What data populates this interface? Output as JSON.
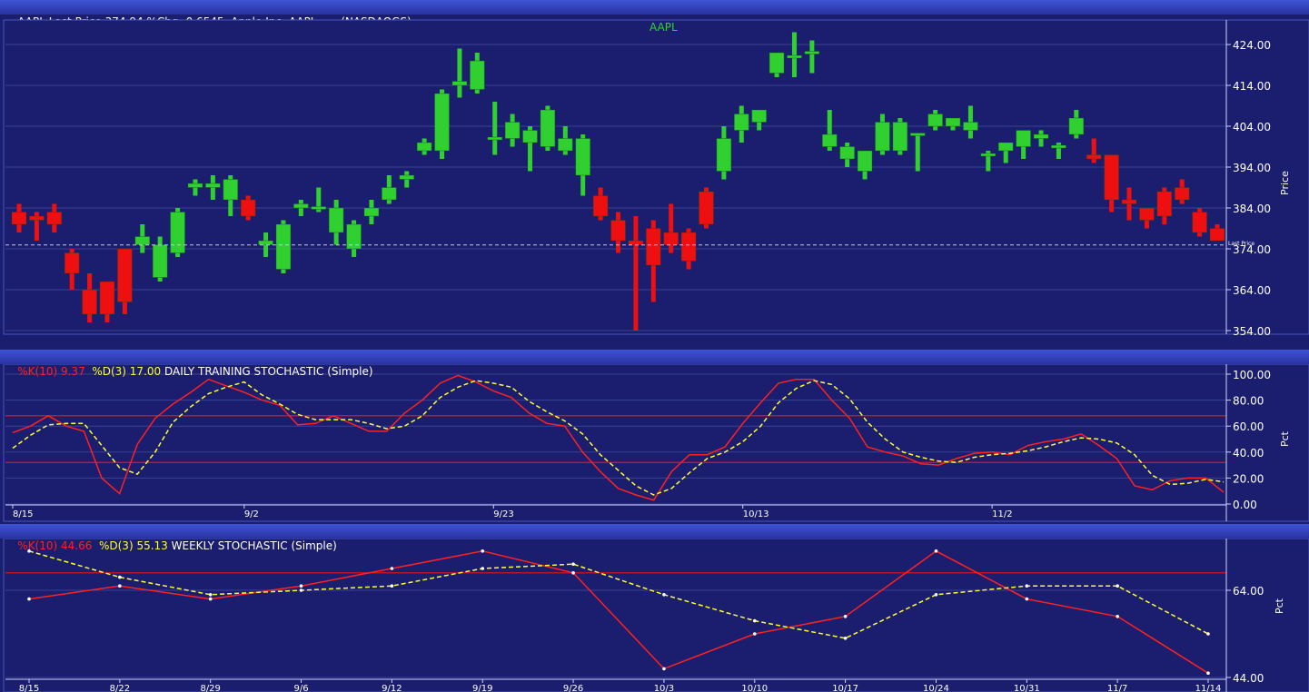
{
  "header": {
    "main": "AAPL.Last Price 374.94 %Chg -0.6545  Apple Inc.-AAPL       (NASDAQGS)"
  },
  "panels": {
    "daily": {
      "k_label": "%K(10) 9.37",
      "d_label": "%D(3) 17.00",
      "title": "DAILY TRAINING STOCHASTIC (Simple)"
    },
    "weekly": {
      "k_label": "%K(10) 44.66",
      "d_label": "%D(3) 55.13",
      "title": "WEEKLY STOCHASTIC (Simple)"
    }
  },
  "colors": {
    "up": "#30d030",
    "down": "#ee1010",
    "k_line": "#ff2020",
    "d_line": "#ffff30",
    "bg": "#1b1e6e",
    "grid": "#3b4095"
  },
  "chart_data": [
    {
      "type": "candlestick",
      "title": "AAPL",
      "ylabel": "Price",
      "ylim": [
        354,
        428
      ],
      "yticks": [
        "424.00",
        "414.00",
        "404.00",
        "394.00",
        "384.00",
        "374.00",
        "364.00",
        "354.00"
      ],
      "last_price": 374.94,
      "last_price_label": "Last Price",
      "candles": [
        {
          "o": 383,
          "h": 385,
          "l": 378,
          "c": 380
        },
        {
          "o": 382,
          "h": 383,
          "l": 376,
          "c": 381
        },
        {
          "o": 383,
          "h": 385,
          "l": 378,
          "c": 380
        },
        {
          "o": 373,
          "h": 374,
          "l": 364,
          "c": 368
        },
        {
          "o": 364,
          "h": 368,
          "l": 356,
          "c": 358
        },
        {
          "o": 366,
          "h": 366,
          "l": 356,
          "c": 358
        },
        {
          "o": 374,
          "h": 374,
          "l": 358,
          "c": 361
        },
        {
          "o": 375,
          "h": 380,
          "l": 373,
          "c": 377
        },
        {
          "o": 367,
          "h": 377,
          "l": 366,
          "c": 375
        },
        {
          "o": 373,
          "h": 384,
          "l": 372,
          "c": 383
        },
        {
          "o": 389,
          "h": 391,
          "l": 387,
          "c": 390
        },
        {
          "o": 389,
          "h": 392,
          "l": 386,
          "c": 390
        },
        {
          "o": 386,
          "h": 392,
          "l": 382,
          "c": 391
        },
        {
          "o": 386,
          "h": 387,
          "l": 381,
          "c": 382
        },
        {
          "o": 375,
          "h": 378,
          "l": 372,
          "c": 376
        },
        {
          "o": 369,
          "h": 381,
          "l": 368,
          "c": 380
        },
        {
          "o": 384,
          "h": 386,
          "l": 382,
          "c": 385
        },
        {
          "o": 384,
          "h": 389,
          "l": 383,
          "c": 384
        },
        {
          "o": 378,
          "h": 386,
          "l": 375,
          "c": 384
        },
        {
          "o": 374,
          "h": 381,
          "l": 372,
          "c": 380
        },
        {
          "o": 382,
          "h": 386,
          "l": 380,
          "c": 384
        },
        {
          "o": 386,
          "h": 392,
          "l": 385,
          "c": 389
        },
        {
          "o": 391,
          "h": 393,
          "l": 389,
          "c": 392
        },
        {
          "o": 398,
          "h": 401,
          "l": 397,
          "c": 400
        },
        {
          "o": 398,
          "h": 413,
          "l": 396,
          "c": 412
        },
        {
          "o": 414,
          "h": 423,
          "l": 411,
          "c": 415
        },
        {
          "o": 413,
          "h": 422,
          "l": 412,
          "c": 420
        },
        {
          "o": 401,
          "h": 410,
          "l": 397,
          "c": 401
        },
        {
          "o": 401,
          "h": 407,
          "l": 399,
          "c": 405
        },
        {
          "o": 400,
          "h": 404,
          "l": 393,
          "c": 403
        },
        {
          "o": 399,
          "h": 409,
          "l": 398,
          "c": 408
        },
        {
          "o": 398,
          "h": 404,
          "l": 397,
          "c": 401
        },
        {
          "o": 392,
          "h": 402,
          "l": 387,
          "c": 401
        },
        {
          "o": 387,
          "h": 389,
          "l": 381,
          "c": 382
        },
        {
          "o": 381,
          "h": 383,
          "l": 373,
          "c": 376
        },
        {
          "o": 376,
          "h": 382,
          "l": 354,
          "c": 375
        },
        {
          "o": 379,
          "h": 381,
          "l": 361,
          "c": 370
        },
        {
          "o": 378,
          "h": 385,
          "l": 373,
          "c": 375
        },
        {
          "o": 378,
          "h": 379,
          "l": 369,
          "c": 371
        },
        {
          "o": 388,
          "h": 389,
          "l": 379,
          "c": 380
        },
        {
          "o": 393,
          "h": 404,
          "l": 391,
          "c": 401
        },
        {
          "o": 403,
          "h": 409,
          "l": 400,
          "c": 407
        },
        {
          "o": 405,
          "h": 408,
          "l": 403,
          "c": 408
        },
        {
          "o": 417,
          "h": 422,
          "l": 416,
          "c": 422
        },
        {
          "o": 421,
          "h": 427,
          "l": 416,
          "c": 421
        },
        {
          "o": 422,
          "h": 425,
          "l": 417,
          "c": 422
        },
        {
          "o": 399,
          "h": 408,
          "l": 398,
          "c": 402
        },
        {
          "o": 396,
          "h": 400,
          "l": 394,
          "c": 399
        },
        {
          "o": 393,
          "h": 398,
          "l": 391,
          "c": 398
        },
        {
          "o": 398,
          "h": 407,
          "l": 397,
          "c": 405
        },
        {
          "o": 398,
          "h": 406,
          "l": 397,
          "c": 405
        },
        {
          "o": 402,
          "h": 402,
          "l": 393,
          "c": 402
        },
        {
          "o": 404,
          "h": 408,
          "l": 403,
          "c": 407
        },
        {
          "o": 404,
          "h": 406,
          "l": 403,
          "c": 406
        },
        {
          "o": 403,
          "h": 409,
          "l": 401,
          "c": 405
        },
        {
          "o": 397,
          "h": 398,
          "l": 393,
          "c": 397
        },
        {
          "o": 398,
          "h": 400,
          "l": 395,
          "c": 400
        },
        {
          "o": 399,
          "h": 403,
          "l": 396,
          "c": 403
        },
        {
          "o": 401,
          "h": 403,
          "l": 399,
          "c": 402
        },
        {
          "o": 399,
          "h": 400,
          "l": 396,
          "c": 399
        },
        {
          "o": 402,
          "h": 408,
          "l": 401,
          "c": 406
        },
        {
          "o": 397,
          "h": 401,
          "l": 395,
          "c": 396
        },
        {
          "o": 397,
          "h": 397,
          "l": 383,
          "c": 386
        },
        {
          "o": 386,
          "h": 389,
          "l": 381,
          "c": 385
        },
        {
          "o": 384,
          "h": 384,
          "l": 379,
          "c": 381
        },
        {
          "o": 388,
          "h": 389,
          "l": 380,
          "c": 382
        },
        {
          "o": 389,
          "h": 391,
          "l": 385,
          "c": 386
        },
        {
          "o": 383,
          "h": 384,
          "l": 377,
          "c": 378
        },
        {
          "o": 379,
          "h": 380,
          "l": 376,
          "c": 376
        }
      ]
    },
    {
      "type": "line",
      "title": "DAILY TRAINING STOCHASTIC (Simple)",
      "ylabel": "Pct",
      "ylim": [
        0,
        100
      ],
      "yticks": [
        "100.00",
        "80.00",
        "60.00",
        "40.00",
        "20.00",
        "0.00"
      ],
      "hlines": [
        68,
        32
      ],
      "xtick_labels": [
        {
          "i": 0,
          "label": "8/15"
        },
        {
          "i": 13,
          "label": "9/2"
        },
        {
          "i": 27,
          "label": "9/23"
        },
        {
          "i": 41,
          "label": "10/13"
        },
        {
          "i": 55,
          "label": "11/2"
        }
      ],
      "series": [
        {
          "name": "%K(10)",
          "values": [
            55,
            60,
            68,
            60,
            56,
            20,
            8,
            46,
            66,
            77,
            86,
            96,
            91,
            86,
            80,
            76,
            61,
            62,
            68,
            62,
            56,
            56,
            70,
            80,
            93,
            99,
            94,
            87,
            82,
            70,
            62,
            60,
            40,
            25,
            12,
            7,
            3,
            25,
            38,
            38,
            44,
            62,
            78,
            93,
            96,
            96,
            80,
            66,
            44,
            40,
            37,
            31,
            30,
            35,
            39,
            40,
            38,
            45,
            48,
            50,
            54,
            45,
            35,
            14,
            11,
            18,
            20,
            20,
            9
          ]
        },
        {
          "name": "%D(3)",
          "values": [
            43,
            53,
            61,
            62,
            62,
            45,
            28,
            23,
            40,
            63,
            75,
            85,
            90,
            94,
            84,
            77,
            69,
            65,
            65,
            65,
            62,
            58,
            60,
            68,
            82,
            90,
            95,
            93,
            90,
            79,
            71,
            64,
            54,
            38,
            26,
            14,
            7,
            12,
            24,
            35,
            40,
            48,
            60,
            78,
            89,
            95,
            92,
            81,
            63,
            50,
            40,
            36,
            33,
            32,
            36,
            38,
            39,
            41,
            44,
            48,
            51,
            50,
            47,
            38,
            22,
            15,
            16,
            19,
            17
          ]
        }
      ]
    },
    {
      "type": "line",
      "title": "WEEKLY STOCHASTIC (Simple)",
      "ylabel": "Pct",
      "ylim": [
        44,
        76
      ],
      "yticks": [
        "64.00",
        "44.00"
      ],
      "hlines": [
        68
      ],
      "categories": [
        "8/15",
        "8/22",
        "8/29",
        "9/6",
        "9/12",
        "9/19",
        "9/26",
        "10/3",
        "10/10",
        "10/17",
        "10/24",
        "10/31",
        "11/7",
        "11/14"
      ],
      "series": [
        {
          "name": "%K(10)",
          "values": [
            62,
            65,
            62,
            65,
            69,
            73,
            68,
            46,
            54,
            58,
            73,
            62,
            58,
            45
          ]
        },
        {
          "name": "%D(3)",
          "values": [
            73,
            67,
            63,
            64,
            65,
            69,
            70,
            63,
            57,
            53,
            63,
            65,
            65,
            54
          ]
        }
      ]
    }
  ]
}
